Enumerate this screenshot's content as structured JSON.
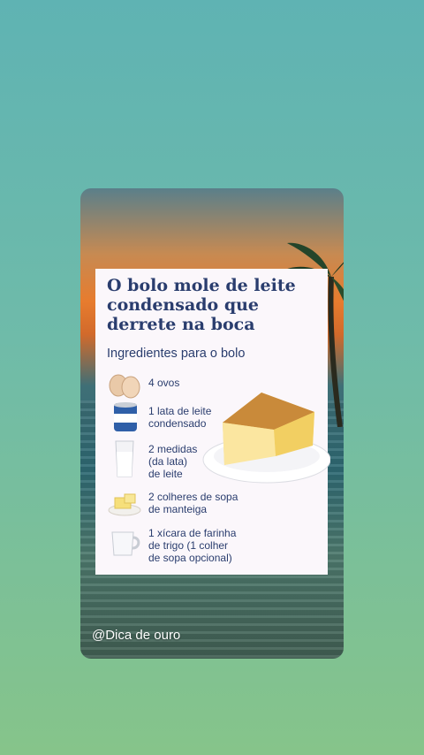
{
  "recipe": {
    "title": "O bolo mole de leite condensado que derrete na boca",
    "subtitle": "Ingredientes para o bolo",
    "ingredients": [
      {
        "icon": "eggs-icon",
        "text": "4 ovos"
      },
      {
        "icon": "condensed-milk-can-icon",
        "text": "1 lata de leite\ncondensado"
      },
      {
        "icon": "milk-glass-icon",
        "text": "2 medidas\n(da lata)\nde leite"
      },
      {
        "icon": "butter-icon",
        "text": "2 colheres de sopa\nde manteiga"
      },
      {
        "icon": "cup-icon",
        "text": "1 xícara de farinha\nde trigo (1 colher\nde sopa opcional)"
      }
    ]
  },
  "footer": {
    "handle": "@Dica de ouro"
  },
  "colors": {
    "title": "#2a3d6e",
    "card": "#fbf7fb",
    "background": "#6fbba9"
  }
}
